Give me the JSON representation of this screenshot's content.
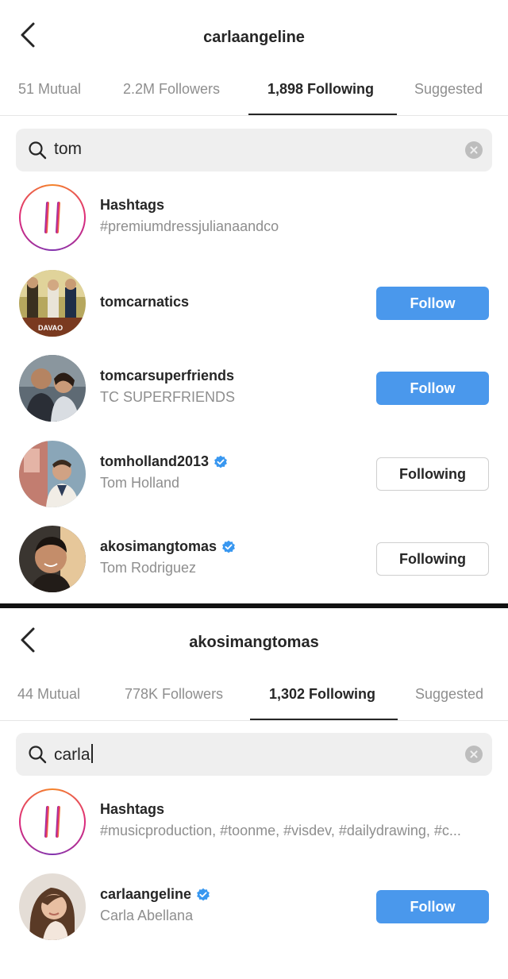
{
  "screens": [
    {
      "title": "carlaangeline",
      "tabs": [
        {
          "label": "51 Mutual"
        },
        {
          "label": "2.2M Followers"
        },
        {
          "label": "1,898 Following"
        },
        {
          "label": "Suggested"
        }
      ],
      "search": {
        "query": "tom"
      },
      "rows": [
        {
          "name": "Hashtags",
          "sub": "#premiumdressjulianaandco"
        },
        {
          "name": "tomcarnatics",
          "sub": "",
          "button": "Follow",
          "avatar_text": "DAVAO"
        },
        {
          "name": "tomcarsuperfriends",
          "sub": "TC SUPERFRIENDS",
          "button": "Follow"
        },
        {
          "name": "tomholland2013",
          "sub": "Tom Holland",
          "button": "Following",
          "verified": true
        },
        {
          "name": "akosimangtomas",
          "sub": "Tom Rodriguez",
          "button": "Following",
          "verified": true
        }
      ]
    },
    {
      "title": "akosimangtomas",
      "tabs": [
        {
          "label": "44 Mutual"
        },
        {
          "label": "778K Followers"
        },
        {
          "label": "1,302 Following"
        },
        {
          "label": "Suggested"
        }
      ],
      "search": {
        "query": "carla"
      },
      "rows": [
        {
          "name": "Hashtags",
          "sub": "#musicproduction, #toonme, #visdev, #dailydrawing, #c..."
        },
        {
          "name": "carlaangeline",
          "sub": "Carla Abellana",
          "button": "Follow",
          "verified": true
        }
      ]
    }
  ],
  "colors": {
    "follow_button": "#4a98ec",
    "verified_badge": "#3897f0",
    "active_tab_underline": "#262626"
  },
  "icons": [
    "back-chevron-icon",
    "search-icon",
    "clear-icon",
    "hashtag-icon",
    "verified-badge-icon"
  ]
}
